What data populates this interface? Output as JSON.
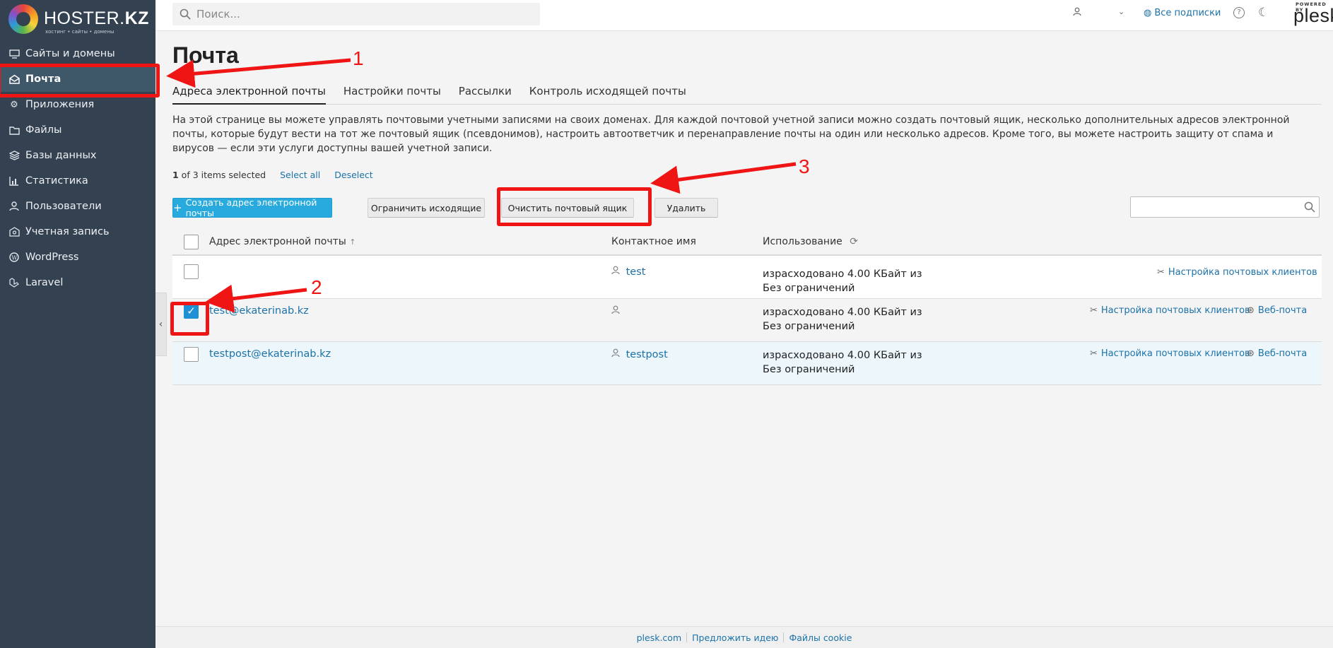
{
  "brand": {
    "name_regular": "HOSTER.",
    "name_bold": "KZ",
    "tagline": "хостинг • сайты • домены"
  },
  "sidebar": {
    "items": [
      {
        "label": "Сайты и домены",
        "icon": "monitor-icon",
        "active": false
      },
      {
        "label": "Почта",
        "icon": "mail-icon",
        "active": true
      },
      {
        "label": "Приложения",
        "icon": "gear-icon",
        "active": false
      },
      {
        "label": "Файлы",
        "icon": "folder-icon",
        "active": false
      },
      {
        "label": "Базы данных",
        "icon": "layers-icon",
        "active": false
      },
      {
        "label": "Статистика",
        "icon": "bar-chart-icon",
        "active": false
      },
      {
        "label": "Пользователи",
        "icon": "user-icon",
        "active": false
      },
      {
        "label": "Учетная запись",
        "icon": "account-icon",
        "active": false
      },
      {
        "label": "WordPress",
        "icon": "wordpress-icon",
        "active": false
      },
      {
        "label": "Laravel",
        "icon": "laravel-icon",
        "active": false
      }
    ]
  },
  "topbar": {
    "search_placeholder": "Поиск...",
    "subscriptions": "Все подписки",
    "plesk_powered": "POWERED BY",
    "plesk_name": "plesk"
  },
  "page": {
    "title": "Почта",
    "tabs": [
      "Адреса электронной почты",
      "Настройки почты",
      "Рассылки",
      "Контроль исходящей почты"
    ],
    "active_tab": 0,
    "description": "На этой странице вы можете управлять почтовыми учетными записями на своих доменах. Для каждой почтовой учетной записи можно создать почтовый ящик, несколько дополнительных адресов электронной почты, которые будут вести на тот же почтовый ящик (псевдонимов), настроить автоответчик и перенаправление почты на один или несколько адресов. Кроме того, вы можете настроить защиту от спама и вирусов — если эти услуги доступны вашей учетной записи.",
    "selection": {
      "count": "1",
      "text": " of 3 items selected",
      "select_all": "Select all",
      "deselect": "Deselect"
    }
  },
  "toolbar": {
    "create": "Создать адрес электронной почты",
    "limit": "Ограничить исходящие",
    "clear": "Очистить почтовый ящик",
    "delete": "Удалить"
  },
  "table": {
    "headers": {
      "email": "Адрес электронной почты",
      "sort": "↑",
      "contact": "Контактное имя",
      "usage": "Использование"
    },
    "rows": [
      {
        "email": "",
        "contact": "test",
        "usage_line1": "израсходовано 4.00 КБайт из",
        "usage_line2": "Без ограничений",
        "checked": false,
        "actions": [
          "Настройка почтовых клиентов"
        ]
      },
      {
        "email": "test@ekaterinab.kz",
        "contact": "",
        "usage_line1": "израсходовано 4.00 КБайт из",
        "usage_line2": "Без ограничений",
        "checked": true,
        "actions": [
          "Настройка почтовых клиентов",
          "Веб-почта"
        ]
      },
      {
        "email": "testpost@ekaterinab.kz",
        "contact": "testpost",
        "usage_line1": "израсходовано 4.00 КБайт из",
        "usage_line2": "Без ограничений",
        "checked": false,
        "actions": [
          "Настройка почтовых клиентов",
          "Веб-почта"
        ]
      }
    ]
  },
  "footer": {
    "links": [
      "plesk.com",
      "Предложить идею",
      "Файлы cookie"
    ]
  },
  "annotations": {
    "labels": [
      "1",
      "2",
      "3"
    ],
    "color": "#f01515"
  },
  "colors": {
    "sidebar": "#334151",
    "accent": "#28aade",
    "link": "#1c72a8"
  }
}
